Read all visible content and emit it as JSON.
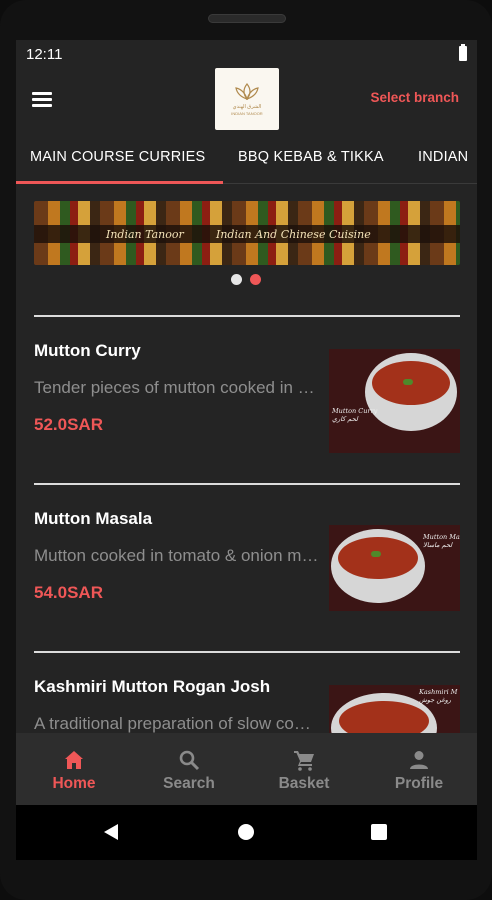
{
  "status": {
    "time": "12:11"
  },
  "header": {
    "logo_arabic": "الشرق الهندي",
    "logo_english": "INDIAN TANOOR",
    "select_branch": "Select branch"
  },
  "tabs": [
    {
      "label": "MAIN COURSE CURRIES",
      "active": true
    },
    {
      "label": "BBQ KEBAB & TIKKA",
      "active": false
    },
    {
      "label": "INDIAN",
      "active": false
    }
  ],
  "banner": {
    "text_left": "Indian Tanoor",
    "text_right": "Indian And Chinese Cuisine",
    "page_count": 2,
    "active_page": 2
  },
  "menu_items": [
    {
      "name": "Mutton Curry",
      "description": "Tender pieces of mutton cooked in a rich curry",
      "price": "52.0SAR",
      "image_caption": "Mutton Curry\nلحم كاري"
    },
    {
      "name": "Mutton Masala",
      "description": "Mutton cooked in tomato & onion masala",
      "price": "54.0SAR",
      "image_caption": "Mutton Masala\nلحم ماسالا"
    },
    {
      "name": "Kashmiri Mutton Rogan Josh",
      "description": "A traditional preparation of slow cooked mutton",
      "price": "",
      "image_caption": "Kashmiri M\nروغن جوش"
    }
  ],
  "bottom_nav": [
    {
      "label": "Home",
      "icon": "home-icon",
      "active": true
    },
    {
      "label": "Search",
      "icon": "search-icon",
      "active": false
    },
    {
      "label": "Basket",
      "icon": "cart-icon",
      "active": false
    },
    {
      "label": "Profile",
      "icon": "person-icon",
      "active": false
    }
  ],
  "colors": {
    "accent": "#ef5757",
    "background": "#242424",
    "nav_background": "#2d2d2d",
    "muted_text": "#8e8e8e"
  }
}
